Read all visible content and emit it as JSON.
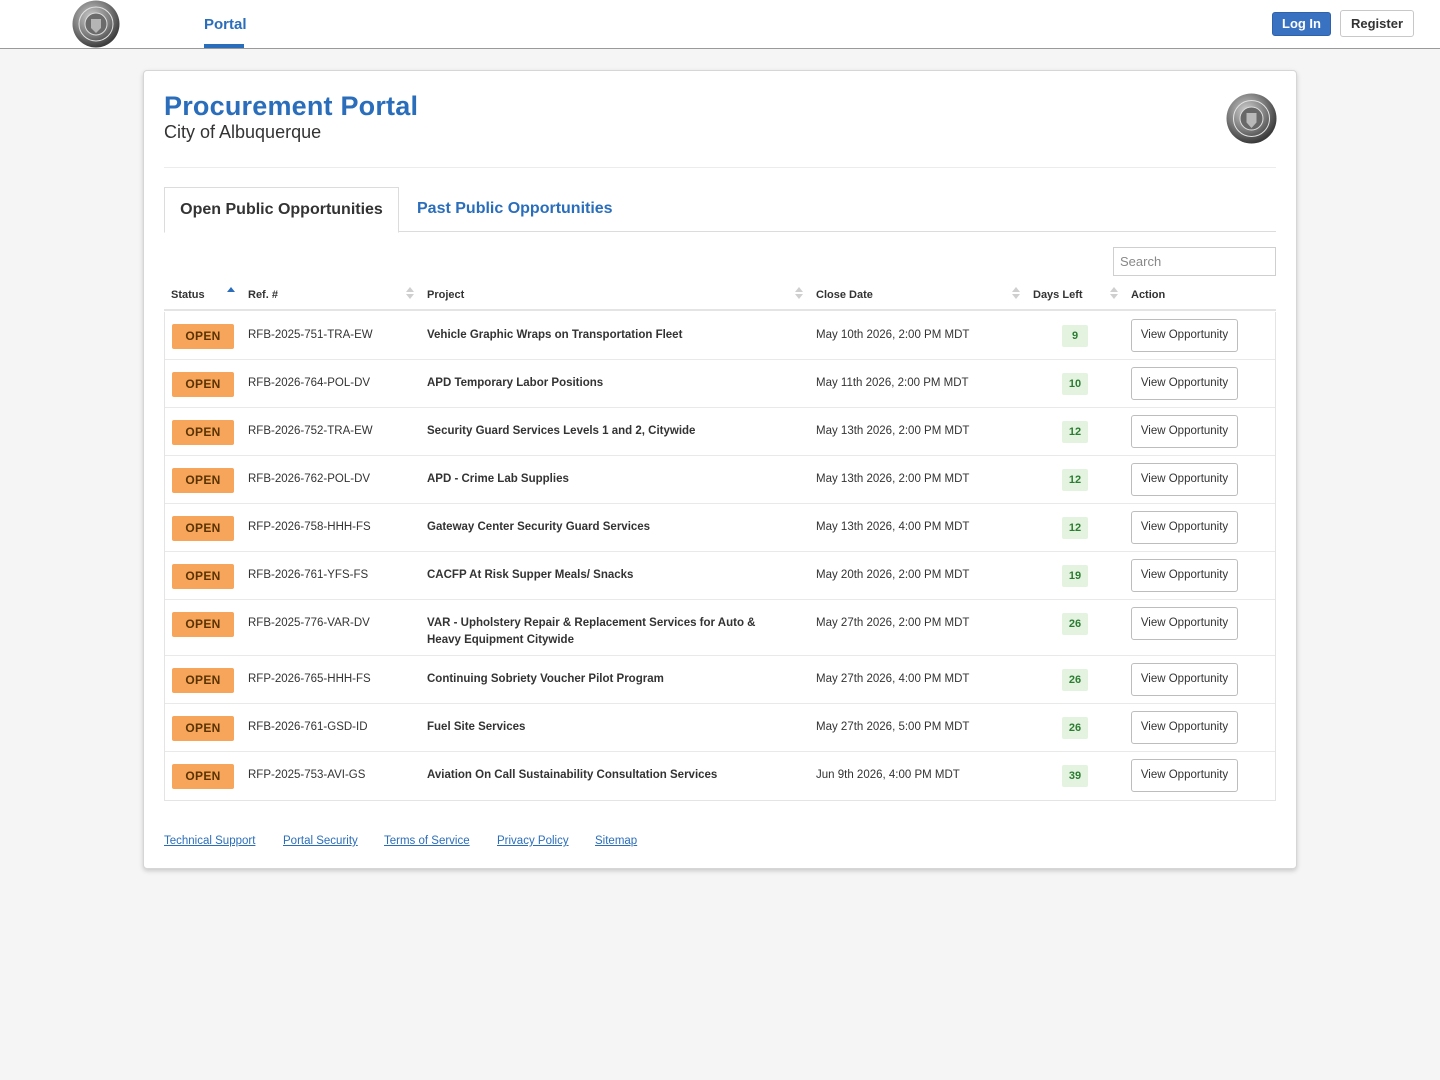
{
  "nav": {
    "portal_label": "Portal",
    "login_label": "Log In",
    "register_label": "Register"
  },
  "header": {
    "title": "Procurement Portal",
    "subtitle": "City of Albuquerque"
  },
  "tabs": [
    {
      "label": "Open Public Opportunities",
      "active": true
    },
    {
      "label": "Past Public Opportunities",
      "active": false
    }
  ],
  "search": {
    "placeholder": "Search",
    "value": ""
  },
  "table": {
    "columns": [
      "Status",
      "Ref. #",
      "Project",
      "Close Date",
      "Days Left",
      "Action"
    ],
    "rows": [
      {
        "status": "OPEN",
        "ref": "RFB-2025-751-TRA-EW",
        "project": "Vehicle Graphic Wraps on Transportation Fleet",
        "close": "May 10th 2026, 2:00 PM MDT",
        "days": "9",
        "action": "View Opportunity"
      },
      {
        "status": "OPEN",
        "ref": "RFB-2026-764-POL-DV",
        "project": "APD Temporary Labor Positions",
        "close": "May 11th 2026, 2:00 PM MDT",
        "days": "10",
        "action": "View Opportunity"
      },
      {
        "status": "OPEN",
        "ref": "RFB-2026-752-TRA-EW",
        "project": "Security Guard Services Levels 1 and 2, Citywide",
        "close": "May 13th 2026, 2:00 PM MDT",
        "days": "12",
        "action": "View Opportunity"
      },
      {
        "status": "OPEN",
        "ref": "RFB-2026-762-POL-DV",
        "project": "APD - Crime Lab Supplies",
        "close": "May 13th 2026, 2:00 PM MDT",
        "days": "12",
        "action": "View Opportunity"
      },
      {
        "status": "OPEN",
        "ref": "RFP-2026-758-HHH-FS",
        "project": "Gateway Center Security Guard Services",
        "close": "May 13th 2026, 4:00 PM MDT",
        "days": "12",
        "action": "View Opportunity"
      },
      {
        "status": "OPEN",
        "ref": "RFB-2026-761-YFS-FS",
        "project": "CACFP At Risk Supper Meals/ Snacks",
        "close": "May 20th 2026, 2:00 PM MDT",
        "days": "19",
        "action": "View Opportunity"
      },
      {
        "status": "OPEN",
        "ref": "RFB-2025-776-VAR-DV",
        "project": "VAR - Upholstery Repair & Replacement Services for Auto & Heavy Equipment Citywide",
        "close": "May 27th 2026, 2:00 PM MDT",
        "days": "26",
        "action": "View Opportunity"
      },
      {
        "status": "OPEN",
        "ref": "RFP-2026-765-HHH-FS",
        "project": "Continuing Sobriety Voucher Pilot Program",
        "close": "May 27th 2026, 4:00 PM MDT",
        "days": "26",
        "action": "View Opportunity"
      },
      {
        "status": "OPEN",
        "ref": "RFB-2026-761-GSD-ID",
        "project": "Fuel Site Services",
        "close": "May 27th 2026, 5:00 PM MDT",
        "days": "26",
        "action": "View Opportunity"
      },
      {
        "status": "OPEN",
        "ref": "RFP-2025-753-AVI-GS",
        "project": "Aviation On Call Sustainability Consultation Services",
        "close": "Jun 9th 2026, 4:00 PM MDT",
        "days": "39",
        "action": "View Opportunity"
      }
    ]
  },
  "footer": {
    "links": [
      "Technical Support",
      "Portal Security",
      "Terms of Service",
      "Privacy Policy",
      "Sitemap"
    ]
  },
  "colors": {
    "brand": "#2a6ebb",
    "status_open_bg": "#f6a55a",
    "days_bg": "#e4f3e0",
    "days_text": "#2c7d33"
  },
  "icons": {
    "city_seal": "city-seal-icon",
    "sort": "sort-arrows-icon"
  }
}
